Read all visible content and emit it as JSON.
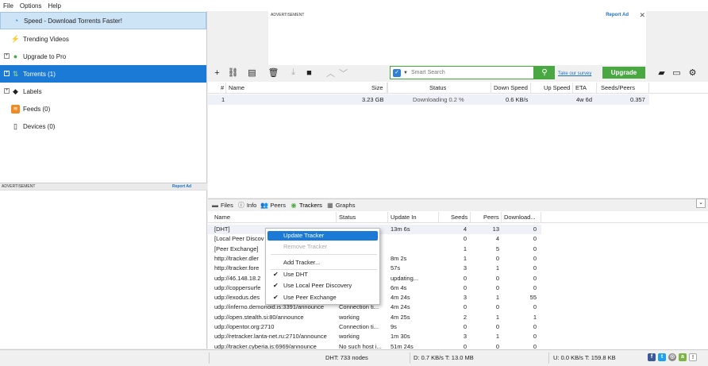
{
  "menu": [
    "File",
    "Options",
    "Help"
  ],
  "sidebar": {
    "items": [
      {
        "label": "Speed - Download Torrents Faster!",
        "icon": "speed-icon"
      },
      {
        "label": "Trending Videos",
        "icon": "lightning-icon"
      },
      {
        "label": "Upgrade to Pro",
        "icon": "upgrade-icon"
      },
      {
        "label": "Torrents (1)",
        "icon": "torrents-icon"
      },
      {
        "label": "Labels",
        "icon": "label-icon"
      },
      {
        "label": "Feeds (0)",
        "icon": "rss-icon"
      },
      {
        "label": "Devices (0)",
        "icon": "device-icon"
      }
    ],
    "ad_label": "ADVERTISEMENT",
    "ad_report": "Report Ad"
  },
  "top_ad": {
    "label": "ADVERTISEMENT",
    "report": "Report Ad",
    "close": "✕"
  },
  "toolbar": {
    "search_placeholder": "Smart Search",
    "survey": "Take our survey",
    "upgrade": "Upgrade"
  },
  "torrents": {
    "columns": [
      "#",
      "Name",
      "Size",
      "Status",
      "Down Speed",
      "Up Speed",
      "ETA",
      "Seeds/Peers"
    ],
    "rows": [
      {
        "num": "1",
        "name": "",
        "size": "3.23 GB",
        "status": "Downloading 0.2 %",
        "down": "0.6 KB/s",
        "up": "",
        "eta": "4w 6d",
        "seeds": "0.357"
      }
    ]
  },
  "tabs": [
    "Files",
    "Info",
    "Peers",
    "Trackers",
    "Graphs"
  ],
  "trackers": {
    "columns": [
      "Name",
      "Status",
      "Update In",
      "Seeds",
      "Peers",
      "Download..."
    ],
    "rows": [
      {
        "name": "[DHT]",
        "status": "",
        "update": "13m 6s",
        "seeds": "4",
        "peers": "13",
        "dl": "0"
      },
      {
        "name": "[Local Peer Discov",
        "status": "",
        "update": "",
        "seeds": "0",
        "peers": "4",
        "dl": "0"
      },
      {
        "name": "[Peer Exchange]",
        "status": "",
        "update": "",
        "seeds": "1",
        "peers": "5",
        "dl": "0"
      },
      {
        "name": "http://tracker.dler",
        "status": "",
        "update": "8m 2s",
        "seeds": "1",
        "peers": "0",
        "dl": "0"
      },
      {
        "name": "http://tracker.fore",
        "status": "",
        "update": "57s",
        "seeds": "3",
        "peers": "1",
        "dl": "0"
      },
      {
        "name": "udp://46.148.18.2",
        "status": "",
        "update": "updating...",
        "seeds": "0",
        "peers": "0",
        "dl": "0"
      },
      {
        "name": "udp://coppersurfe",
        "status": "",
        "update": "6m 4s",
        "seeds": "0",
        "peers": "0",
        "dl": "0"
      },
      {
        "name": "udp://exodus.des",
        "status": "",
        "update": "4m 24s",
        "seeds": "3",
        "peers": "1",
        "dl": "55"
      },
      {
        "name": "udp://inferno.demonoid.is:3391/announce",
        "status": "Connection ti...",
        "update": "4m 24s",
        "seeds": "0",
        "peers": "0",
        "dl": "0"
      },
      {
        "name": "udp://open.stealth.si:80/announce",
        "status": "working",
        "update": "4m 25s",
        "seeds": "2",
        "peers": "1",
        "dl": "1"
      },
      {
        "name": "udp://opentor.org:2710",
        "status": "Connection ti...",
        "update": "9s",
        "seeds": "0",
        "peers": "0",
        "dl": "0"
      },
      {
        "name": "udp://retracker.lanta-net.ru:2710/announce",
        "status": "working",
        "update": "1m 30s",
        "seeds": "3",
        "peers": "1",
        "dl": "0"
      },
      {
        "name": "udp://tracker.cyberia.is:6969/announce",
        "status": "No such host i...",
        "update": "51m 24s",
        "seeds": "0",
        "peers": "0",
        "dl": "0"
      }
    ]
  },
  "context_menu": {
    "items": [
      {
        "label": "Update Tracker",
        "state": "highlighted"
      },
      {
        "label": "Remove Tracker",
        "state": "disabled"
      },
      {
        "label": "Add Tracker...",
        "state": "normal"
      },
      {
        "label": "Use DHT",
        "state": "checked"
      },
      {
        "label": "Use Local Peer Discovery",
        "state": "checked"
      },
      {
        "label": "Use Peer Exchange",
        "state": "checked"
      }
    ]
  },
  "status": {
    "dht": "DHT: 733 nodes",
    "down": "D: 0.7 KB/s T: 13.0 MB",
    "up": "U: 0.0 KB/s T: 159.8 KB"
  },
  "colors": {
    "accent": "#1b7ad6",
    "green": "#4aa843"
  }
}
